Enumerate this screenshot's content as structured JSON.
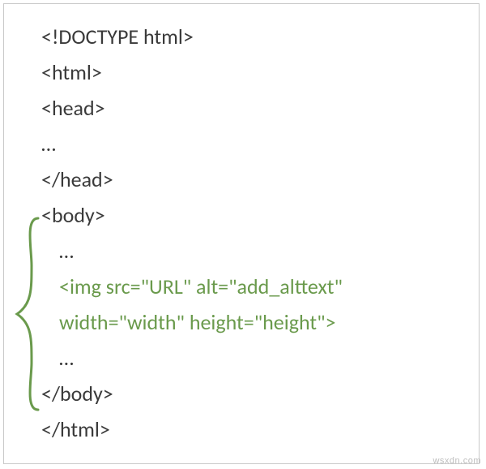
{
  "lines": {
    "l0": "<!DOCTYPE html>",
    "l1": "<html>",
    "l2": "<head>",
    "l3": "…",
    "l4": "</head>",
    "l5": "<body>",
    "l6": "…",
    "l7": "<img src=\"URL\" alt=\"add_alttext\"",
    "l8": "width=\"width\" height=\"height\">",
    "l9": "…",
    "l10": "</body>",
    "l11": "</html>"
  },
  "watermark": "wsxdn.com",
  "colors": {
    "highlight": "#6a9a4c",
    "text": "#3a3a3a",
    "border": "#c9c9c9"
  }
}
